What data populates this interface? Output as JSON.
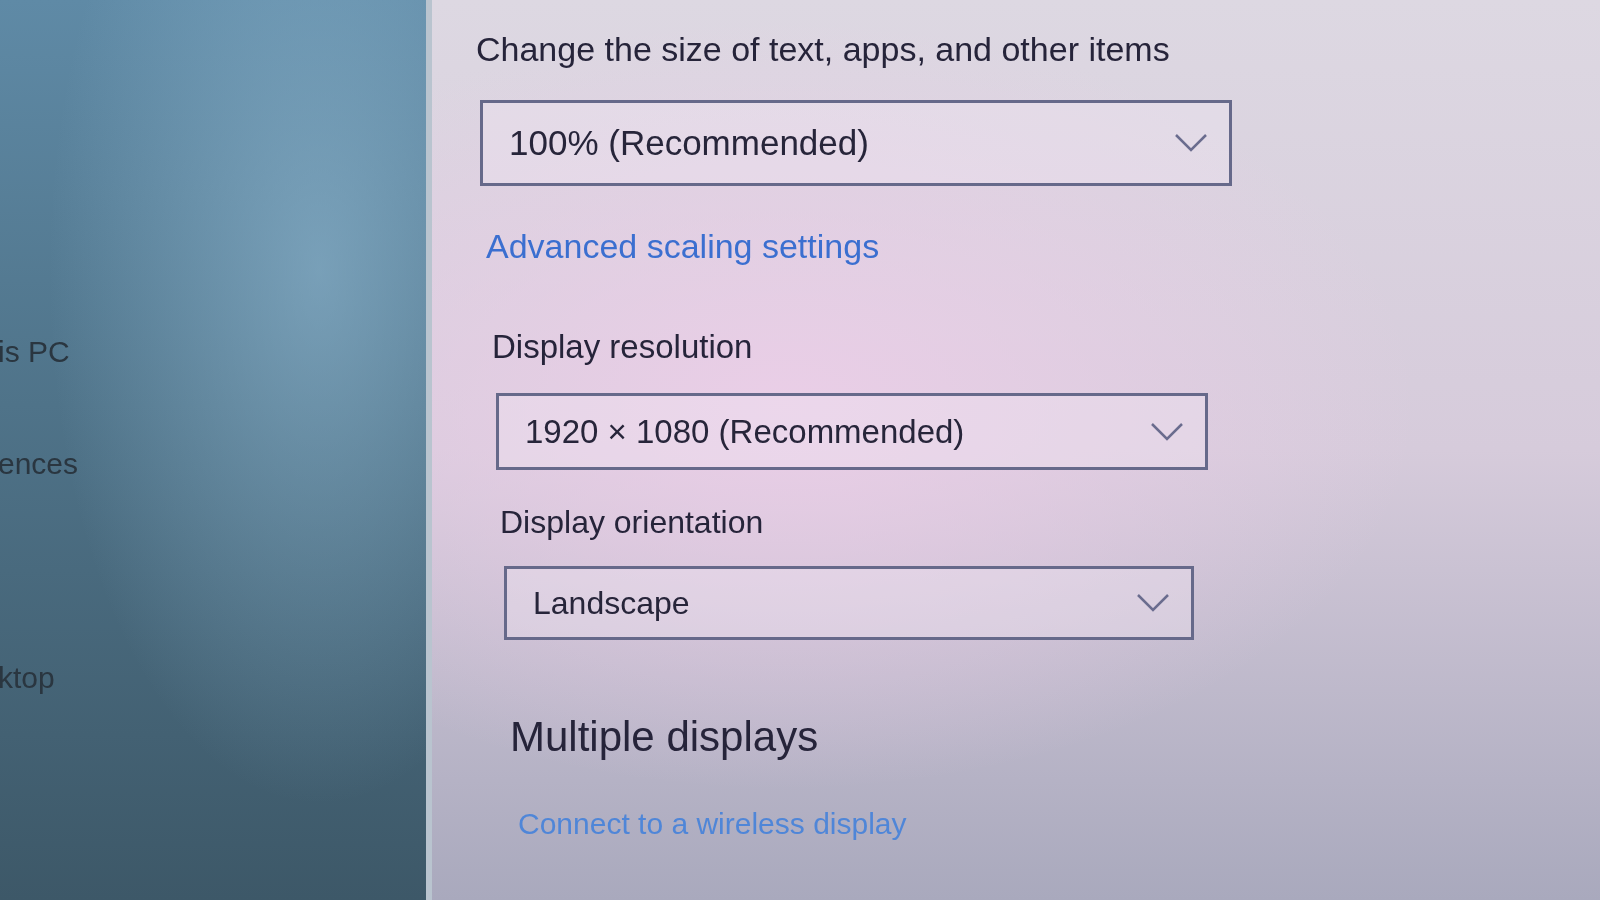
{
  "sidebar": {
    "items": [
      {
        "label": "is PC"
      },
      {
        "label": "ences"
      },
      {
        "label": "ktop"
      }
    ]
  },
  "scaling": {
    "label": "Change the size of text, apps, and other items",
    "dropdown": {
      "value": "100% (Recommended)"
    },
    "link": "Advanced scaling settings"
  },
  "resolution": {
    "label": "Display resolution",
    "dropdown": {
      "value": "1920 × 1080 (Recommended)"
    }
  },
  "orientation": {
    "label": "Display orientation",
    "dropdown": {
      "value": "Landscape"
    }
  },
  "multiple_displays": {
    "heading": "Multiple displays",
    "link": "Connect to a wireless display"
  }
}
